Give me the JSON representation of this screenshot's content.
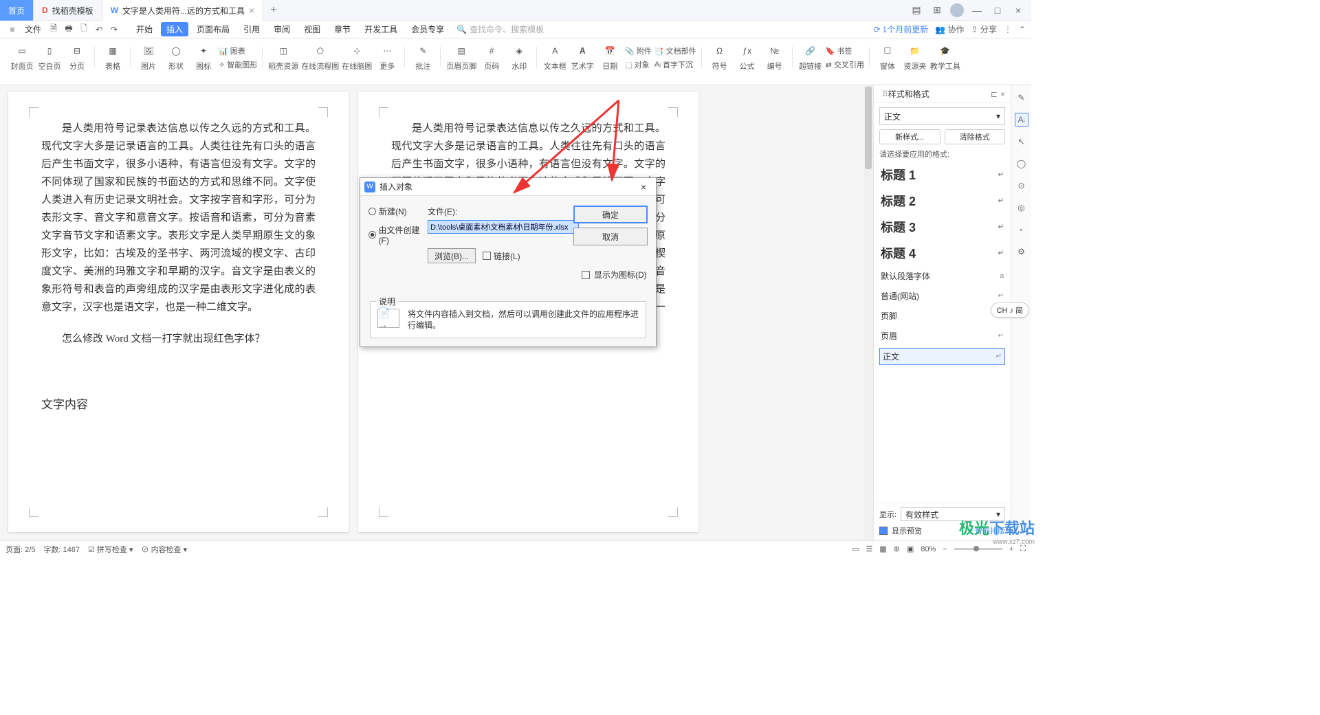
{
  "tabs": {
    "home": "首页",
    "template": "找稻壳模板",
    "doc": "文字是人类用符...远的方式和工具"
  },
  "menubar": {
    "file": "文件",
    "items": [
      "开始",
      "插入",
      "页面布局",
      "引用",
      "审阅",
      "视图",
      "章节",
      "开发工具",
      "会员专享"
    ],
    "active_index": 1,
    "search_hint": "查找命令、搜索模板",
    "update": "1个月前更新",
    "collab": "协作",
    "share": "分享"
  },
  "ribbon": {
    "cover": "封面页",
    "blank": "空白页",
    "break": "分页",
    "table": "表格",
    "picture": "图片",
    "shape": "形状",
    "icon": "图标",
    "smart_lbl": "智能图形",
    "chart": "图表",
    "res": "稻壳资源",
    "flow": "在线流程图",
    "mind": "在线脑图",
    "more": "更多",
    "comment": "批注",
    "hf": "页眉页脚",
    "pnum": "页码",
    "wm": "水印",
    "textbox": "文本框",
    "art": "艺术字",
    "date": "日期",
    "attach": "附件",
    "obj": "对象",
    "parts": "文档部件",
    "drop": "首字下沉",
    "symbol": "符号",
    "formula": "公式",
    "num": "编号",
    "link": "超链接",
    "bm": "书签",
    "xref": "交叉引用",
    "widget": "窗体",
    "reslib": "资源夹",
    "teach": "教学工具"
  },
  "pages": {
    "left": [
      "是人类用符号记录表达信息以传之久远的方式和工具。现代文字大多是记录语言的工具。人类往往先有口头的语言后产生书面文字，很多小语种，有语言但没有文字。文字的不同体现了国家和民族的书面达的方式和思维不同。文字使人类进入有历史记录文明社会。文字按字音和字形，可分为表形文字、音文字和意音文字。按语音和语素，可分为音素文字音节文字和语素文字。表形文字是人类早期原生文的象形文字，比如：古埃及的圣书字、两河流域的楔文字、古印度文字、美洲的玛雅文字和早期的汉字。音文字是由表义的象形符号和表音的声旁组成的汉字是由表形文字进化成的表意文字，汉字也是语文字，也是一种二维文字。",
      "怎么修改 Word 文档一打字就出现红色字体？",
      "文字内容"
    ],
    "right": "是人类用符号记录表达信息以传之久远的方式和工具。现代文字大多是记录语言的工具。人类往往先有口头的语言后产生书面文字，很多小语种，有语言但没有文字。文字的不同体现了国家和民族的书面表达的方式和思维不同。文字使人类进入有历史记录的文明社会。文字按字音和字形，可分为表形文字、表音文字和意音文字。按语音和语素，可分为音素文字、音节文字和语素文字。表形文字是人类早期原生文字的象形文字，比如：古埃及的圣书字、两河流域的楔形文字、古印度文字、美洲的玛雅文字和早期的汉字。意音文字是由表义的象形符号和表音的声旁组成的文字，汉字是由表形文字进化成的表意文字，汉字也是语素文字，也是一种二维文字。"
  },
  "dialog": {
    "title": "插入对象",
    "new": "新建(N)",
    "from_file": "由文件创建(F)",
    "file_lbl": "文件(E):",
    "path": "D:\\tools\\桌面素材\\文档素材\\日期年份.xlsx",
    "browse": "浏览(B)...",
    "link": "链接(L)",
    "show_icon": "显示为图标(D)",
    "ok": "确定",
    "cancel": "取消",
    "desc_title": "说明",
    "desc": "将文件内容插入到文档，然后可以调用创建此文件的应用程序进行编辑。"
  },
  "styles": {
    "panel": "样式和格式",
    "current": "正文",
    "new": "新样式...",
    "clear": "清除格式",
    "hint": "请选择要应用的格式:",
    "items": [
      "标题 1",
      "标题 2",
      "标题 3",
      "标题 4",
      "默认段落字体",
      "普通(网站)",
      "页脚",
      "页眉",
      "正文"
    ],
    "show_lbl": "显示:",
    "show_val": "有效样式",
    "preview": "显示预览",
    "smart": "智能排版"
  },
  "ime": "CH ♪ 简",
  "status": {
    "page": "页面: 2/5",
    "words": "字数: 1467",
    "spell": "拼写检查",
    "content": "内容检查",
    "zoom": "80%"
  }
}
